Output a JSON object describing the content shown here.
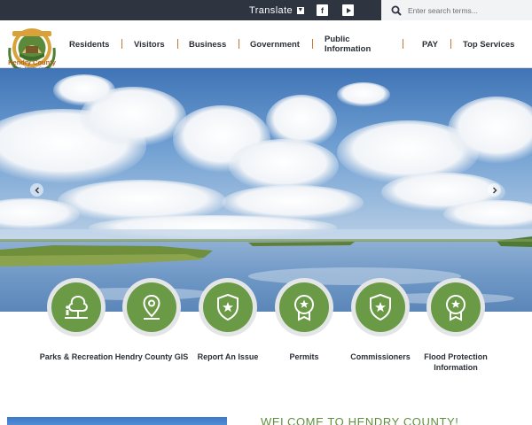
{
  "topbar": {
    "translate_label": "Translate",
    "social": [
      {
        "icon": "facebook-icon",
        "glyph": "f"
      },
      {
        "icon": "youtube-icon"
      }
    ],
    "search": {
      "placeholder": "Enter search terms..."
    }
  },
  "logo": {
    "name": "Hendry County",
    "tagline": "\"Rural... Friendly... Country\"",
    "icon": "county-seal-icon",
    "colors": {
      "gold": "#d9a13a",
      "green": "#5b8a3a"
    }
  },
  "nav": {
    "items": [
      {
        "label": "Residents"
      },
      {
        "label": "Visitors"
      },
      {
        "label": "Business"
      },
      {
        "label": "Government"
      },
      {
        "label": "Public Information"
      },
      {
        "label": "PAY"
      },
      {
        "label": "Top Services"
      }
    ],
    "separator_color": "#c8782b"
  },
  "hero": {
    "image": "lake-and-clouds-photo",
    "prev_icon": "chevron-left-icon",
    "next_icon": "chevron-right-icon"
  },
  "quick_links": [
    {
      "label": "Parks & Recreation",
      "icon": "park-tree-icon"
    },
    {
      "label": "Hendry County GIS",
      "icon": "map-pin-icon"
    },
    {
      "label": "Report An Issue",
      "icon": "shield-star-icon"
    },
    {
      "label": "Permits",
      "icon": "award-badge-icon"
    },
    {
      "label": "Commissioners",
      "icon": "shield-star-icon"
    },
    {
      "label": "Flood Protection Information",
      "icon": "award-badge-icon"
    }
  ],
  "welcome": {
    "title": "WELCOME TO HENDRY COUNTY!"
  },
  "colors": {
    "topbar": "#2e3440",
    "accent_green": "#6a9a45",
    "title_green": "#5f8f3e"
  }
}
